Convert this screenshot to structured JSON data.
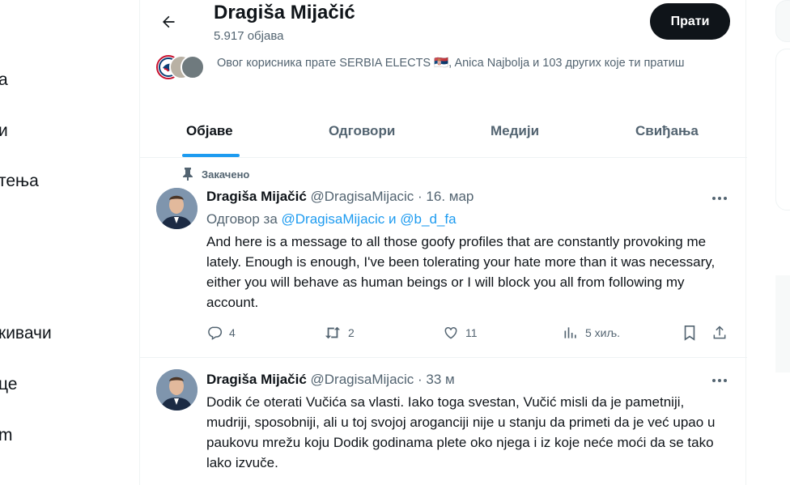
{
  "left_nav": {
    "items": [
      "а",
      "и",
      "тења",
      "кивачи",
      "це",
      "m"
    ]
  },
  "header": {
    "name": "Dragiša Mijačić",
    "post_count": "5.917 објава",
    "follow_label": "Прати"
  },
  "followers_you_know": {
    "text": "Овог корисника прате SERBIA ELECTS 🇷🇸, Anica Najbolja и 103 других које ти пратиш"
  },
  "tabs": [
    {
      "label": "Објаве",
      "active": true
    },
    {
      "label": "Одговори",
      "active": false
    },
    {
      "label": "Медији",
      "active": false
    },
    {
      "label": "Свиђања",
      "active": false
    }
  ],
  "tweets": [
    {
      "pinned_label": "Закачено",
      "name": "Dragiša Mijačić",
      "meta": "@DragisaMijacic · 16. мар",
      "reply_prefix": "Одговор за",
      "reply_mention_1": "@DragisaMijacic",
      "reply_and": "и",
      "reply_mention_2": "@b_d_fa",
      "text": "And here is a message to all those goofy profiles that are constantly provoking me lately. Enough is enough, I've been tolerating your hate more than it was necessary, either you will behave as human beings or I will block you all from following my account.",
      "replies": "4",
      "reposts": "2",
      "likes": "11",
      "views": "5 хиљ."
    },
    {
      "name": "Dragiša Mijačić",
      "meta": "@DragisaMijacic · 33 м",
      "text": "Dodik će oterati Vučića sa vlasti. Iako toga svestan, Vučić misli da je pametniji, mudriji, sposobniji, ali u toj svojoj aroganciji nije u stanju da primeti da je već upao u paukovu mrežu koju Dodik godinama plete oko njega i iz koje neće moći da se tako lako izvuče."
    }
  ],
  "colors": {
    "accent": "#1d9bf0",
    "text": "#0f1419",
    "muted": "#536471",
    "border": "#eff3f4"
  }
}
